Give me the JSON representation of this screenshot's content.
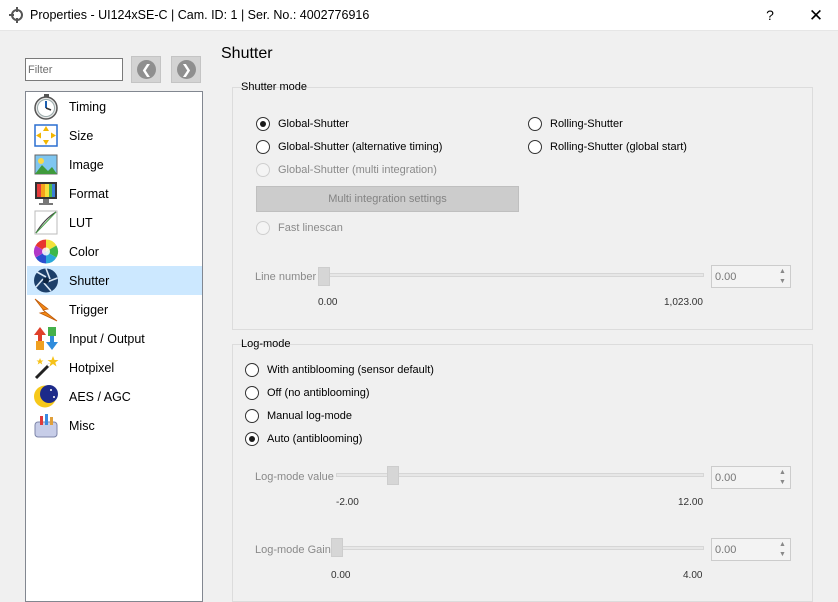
{
  "window": {
    "title": "Properties - UI124xSE-C | Cam. ID: 1 | Ser. No.: 4002776916",
    "help_label": "?",
    "close_label": "✕"
  },
  "filter": {
    "placeholder": "Filter",
    "back_icon": "arrow-left-icon",
    "forward_icon": "arrow-right-icon"
  },
  "sidebar": {
    "items": [
      {
        "label": "Timing",
        "icon": "stopwatch-icon"
      },
      {
        "label": "Size",
        "icon": "resize-icon"
      },
      {
        "label": "Image",
        "icon": "image-icon"
      },
      {
        "label": "Format",
        "icon": "monitor-icon"
      },
      {
        "label": "LUT",
        "icon": "curve-icon"
      },
      {
        "label": "Color",
        "icon": "color-wheel-icon"
      },
      {
        "label": "Shutter",
        "icon": "shutter-icon",
        "selected": true
      },
      {
        "label": "Trigger",
        "icon": "lightning-icon"
      },
      {
        "label": "Input / Output",
        "icon": "io-arrows-icon"
      },
      {
        "label": "Hotpixel",
        "icon": "magic-wand-icon"
      },
      {
        "label": "AES / AGC",
        "icon": "moon-icon"
      },
      {
        "label": "Misc",
        "icon": "toolbox-icon"
      }
    ]
  },
  "main": {
    "title": "Shutter",
    "shutter_mode": {
      "title": "Shutter mode",
      "global_shutter": "Global-Shutter",
      "global_shutter_alt": "Global-Shutter (alternative timing)",
      "global_shutter_multi": "Global-Shutter (multi integration)",
      "multi_integration_settings": "Multi integration settings",
      "fast_linescan": "Fast linescan",
      "rolling_shutter": "Rolling-Shutter",
      "rolling_shutter_global": "Rolling-Shutter (global start)",
      "selected": "Global-Shutter",
      "line_number": {
        "label": "Line number",
        "value": "0.00",
        "min": "0.00",
        "max": "1,023.00",
        "position": 0.0
      }
    },
    "log_mode": {
      "title": "Log-mode",
      "options": [
        "With antiblooming (sensor default)",
        "Off (no antiblooming)",
        "Manual log-mode",
        "Auto (antiblooming)"
      ],
      "selected": "Auto (antiblooming)",
      "value_slider": {
        "label": "Log-mode value",
        "value": "0.00",
        "min": "-2.00",
        "max": "12.00",
        "position": 0.143
      },
      "gain_slider": {
        "label": "Log-mode Gain",
        "value": "0.00",
        "min": "0.00",
        "max": "4.00",
        "position": 0.0
      }
    }
  },
  "colors": {
    "selected_row": "#cce8ff",
    "window_bg": "#f0f0f0"
  }
}
